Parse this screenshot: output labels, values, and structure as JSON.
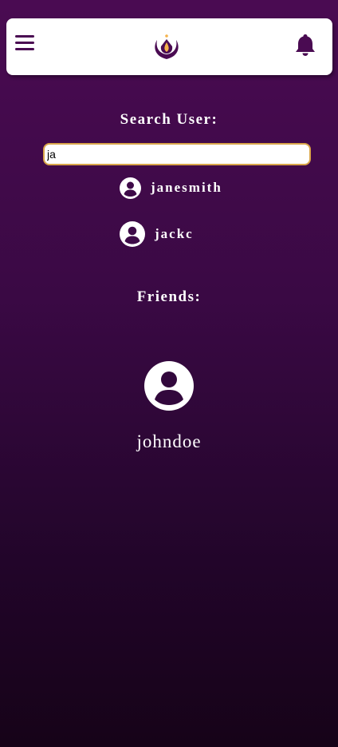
{
  "header": {
    "menu_icon": "hamburger-menu-icon",
    "logo_icon": "lotus-flame-logo",
    "notification_icon": "bell-icon",
    "accent_color": "#4a0b52"
  },
  "search": {
    "label": "Search User:",
    "value": "ja",
    "results": [
      {
        "username": "janesmith",
        "icon": "user-avatar-icon"
      },
      {
        "username": "jackc",
        "icon": "user-avatar-icon"
      }
    ]
  },
  "friends": {
    "label": "Friends:",
    "items": [
      {
        "username": "johndoe",
        "icon": "user-avatar-icon"
      }
    ]
  }
}
